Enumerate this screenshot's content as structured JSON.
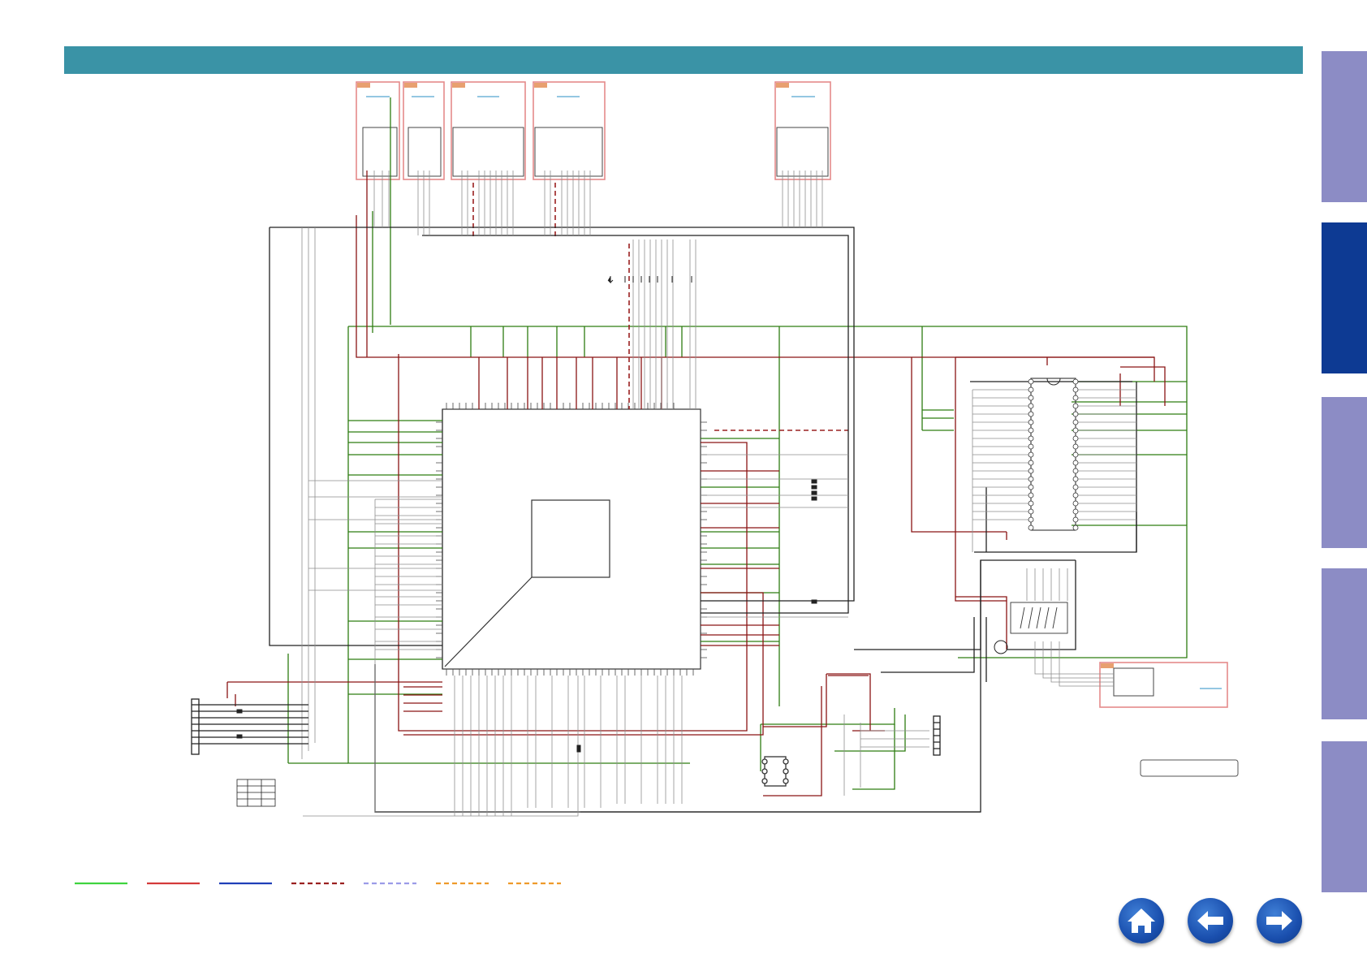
{
  "header": {
    "color": "#3a93a6"
  },
  "side_tabs": [
    {
      "color": "#8c8cc5",
      "active": false
    },
    {
      "color": "#0d3a93",
      "active": true
    },
    {
      "color": "#8c8cc5",
      "active": false
    },
    {
      "color": "#8c8cc5",
      "active": false
    },
    {
      "color": "#8c8cc5",
      "active": false
    }
  ],
  "wire_colors": {
    "ground": "#2e7d12",
    "power": "#8a1414",
    "signal": "#333333",
    "component": "#9a9a9a",
    "module_border": "#e58a8a"
  },
  "legend": [
    {
      "style": "solid",
      "color": "#3fd43f"
    },
    {
      "style": "solid",
      "color": "#d43a3a"
    },
    {
      "style": "solid",
      "color": "#1f3fb8"
    },
    {
      "style": "dashed",
      "color": "#9a2020"
    },
    {
      "style": "dashed",
      "color": "#9b9be8"
    },
    {
      "style": "dashed",
      "color": "#ee9a2a"
    },
    {
      "style": "dashed",
      "color": "#ee9a2a"
    }
  ],
  "nav": {
    "home_icon": "home-icon",
    "back_icon": "arrow-left-icon",
    "forward_icon": "arrow-right-icon"
  }
}
